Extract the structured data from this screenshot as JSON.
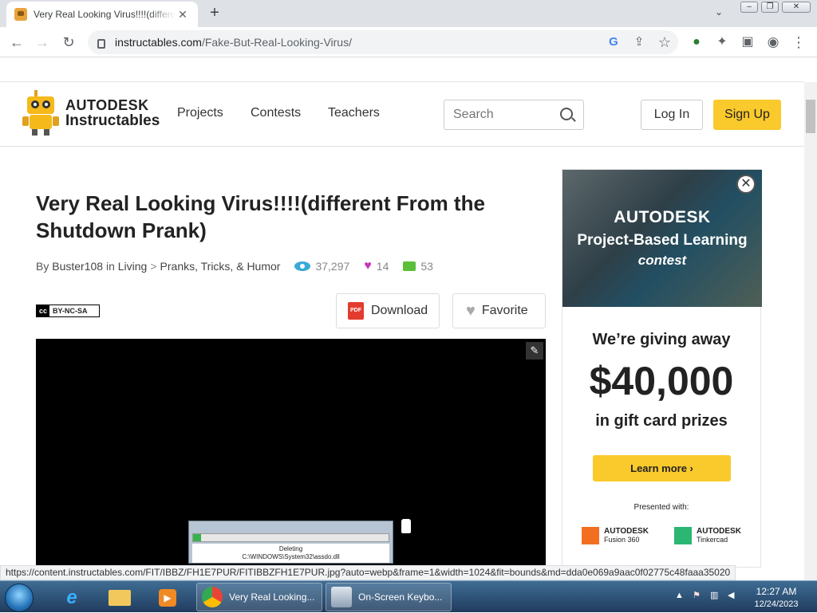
{
  "browser": {
    "tab_title": "Very Real Looking Virus!!!!(different From the Shutdown Prank)",
    "tab_close": "✕",
    "new_tab": "+",
    "url_host": "instructables.com",
    "url_path": "/Fake-But-Real-Looking-Virus/",
    "status_url": "https://content.instructables.com/FIT/IBBZ/FH1E7PUR/FITIBBZFH1E7PUR.jpg?auto=webp&frame=1&width=1024&fit=bounds&md=dda0e069a9aac0f02775c48faaa35020"
  },
  "site": {
    "brand_line1": "AUTODESK",
    "brand_line2": "Instructables",
    "nav": [
      "Projects",
      "Contests",
      "Teachers"
    ],
    "search_placeholder": "Search",
    "login": "Log In",
    "signup": "Sign Up"
  },
  "article": {
    "title": "Very Real Looking Virus!!!!(different From the Shutdown Prank)",
    "by": "By",
    "author": "Buster108",
    "in": "in",
    "category": "Living",
    "sep": ">",
    "subcategory": "Pranks, Tricks, & Humor",
    "views": "37,297",
    "favorites": "14",
    "comments": "53",
    "license_left": "cc",
    "license_right": "BY-NC-SA",
    "download_label": "Download",
    "pdf_label": "PDF",
    "favorite_label": "Favorite",
    "dialog_text_1": "Deleting",
    "dialog_text_2": "C:\\WINDOWS\\System32\\assdo.dll",
    "dialog_progress": 0.04
  },
  "ad": {
    "brand": "AUTODESK",
    "subtitle": "Project-Based Learning",
    "contest": "contest",
    "giving": "We’re giving away",
    "amount": "$40,000",
    "gift": "in gift card prizes",
    "cta": "Learn more ›",
    "presented": "Presented with:",
    "logo1_brand": "AUTODESK",
    "logo1_name": "Fusion 360",
    "logo2_brand": "AUTODESK",
    "logo2_name": "Tinkercad",
    "logo1_color": "#f26f21",
    "logo2_color": "#2bb673"
  },
  "taskbar": {
    "task1": "Very Real Looking...",
    "task2": "On-Screen Keybo...",
    "time": "12:27 AM",
    "date": "12/24/2023"
  },
  "colors": {
    "accent": "#fac92c",
    "views_icon": "#3aa8d8",
    "heart_icon": "#c837b8",
    "comments_icon": "#5bbf3a"
  }
}
